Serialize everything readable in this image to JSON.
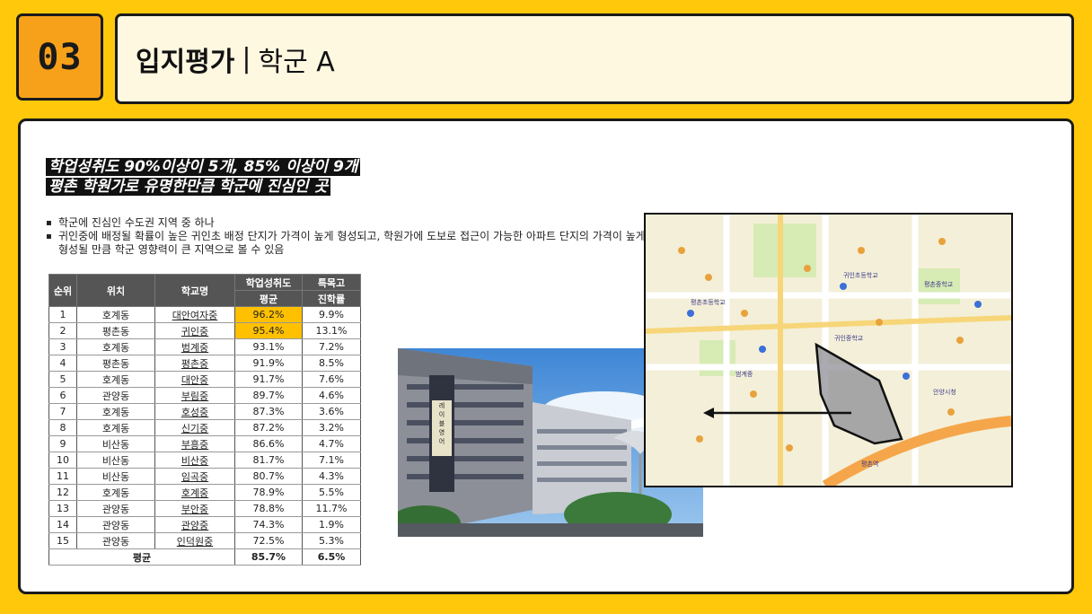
{
  "section": {
    "number": "03"
  },
  "title": {
    "bold": "입지평가",
    "separator": "|",
    "rest": "학군 A"
  },
  "headline": {
    "line1": "학업성취도 90%이상이 5개, 85% 이상이 9개",
    "line2": "평촌 학원가로 유명한만큼 학군에 진심인 곳"
  },
  "bullets": [
    "학군에 진심인 수도권 지역 중 하나",
    "귀인중에 배정될 확률이 높은 귀인초 배정 단지가 가격이 높게 형성되고, 학원가에 도보로 접근이 가능한 아파트 단지의 가격이 높게 형성될 만큼 학군 영향력이 큰 지역으로 볼 수 있음"
  ],
  "table": {
    "headers": {
      "rank": "순위",
      "location": "위치",
      "school": "학교명",
      "achievement": "학업성취도",
      "special": "특목고",
      "avg": "평균",
      "rate": "진학률"
    },
    "rows": [
      {
        "rank": "1",
        "loc": "호계동",
        "school": "대안여자중",
        "ach": "96.2%",
        "rate": "9.9%"
      },
      {
        "rank": "2",
        "loc": "평촌동",
        "school": "귀인중",
        "ach": "95.4%",
        "rate": "13.1%"
      },
      {
        "rank": "3",
        "loc": "호계동",
        "school": "범계중",
        "ach": "93.1%",
        "rate": "7.2%"
      },
      {
        "rank": "4",
        "loc": "평촌동",
        "school": "평촌중",
        "ach": "91.9%",
        "rate": "8.5%"
      },
      {
        "rank": "5",
        "loc": "호계동",
        "school": "대안중",
        "ach": "91.7%",
        "rate": "7.6%"
      },
      {
        "rank": "6",
        "loc": "관양동",
        "school": "부림중",
        "ach": "89.7%",
        "rate": "4.6%"
      },
      {
        "rank": "7",
        "loc": "호계동",
        "school": "호성중",
        "ach": "87.3%",
        "rate": "3.6%"
      },
      {
        "rank": "8",
        "loc": "호계동",
        "school": "신기중",
        "ach": "87.2%",
        "rate": "3.2%"
      },
      {
        "rank": "9",
        "loc": "비산동",
        "school": "부흥중",
        "ach": "86.6%",
        "rate": "4.7%"
      },
      {
        "rank": "10",
        "loc": "비산동",
        "school": "비산중",
        "ach": "81.7%",
        "rate": "7.1%"
      },
      {
        "rank": "11",
        "loc": "비산동",
        "school": "임곡중",
        "ach": "80.7%",
        "rate": "4.3%"
      },
      {
        "rank": "12",
        "loc": "호계동",
        "school": "호계중",
        "ach": "78.9%",
        "rate": "5.5%"
      },
      {
        "rank": "13",
        "loc": "관양동",
        "school": "부안중",
        "ach": "78.8%",
        "rate": "11.7%"
      },
      {
        "rank": "14",
        "loc": "관양동",
        "school": "관양중",
        "ach": "74.3%",
        "rate": "1.9%"
      },
      {
        "rank": "15",
        "loc": "관양동",
        "school": "인덕원중",
        "ach": "72.5%",
        "rate": "5.3%"
      }
    ],
    "average": {
      "label": "평균",
      "ach": "85.7%",
      "rate": "6.5%"
    }
  },
  "photo": {
    "sign": "레이블영어"
  },
  "map": {
    "labels": [
      "평촌초등학교",
      "귀인중학교",
      "범계중",
      "귀인초등학교",
      "평촌중학교",
      "안양시청",
      "평촌역"
    ]
  },
  "colors": {
    "highlight": "#FFC000",
    "frame": "#FFC80A",
    "number_box": "#F7A11A"
  }
}
